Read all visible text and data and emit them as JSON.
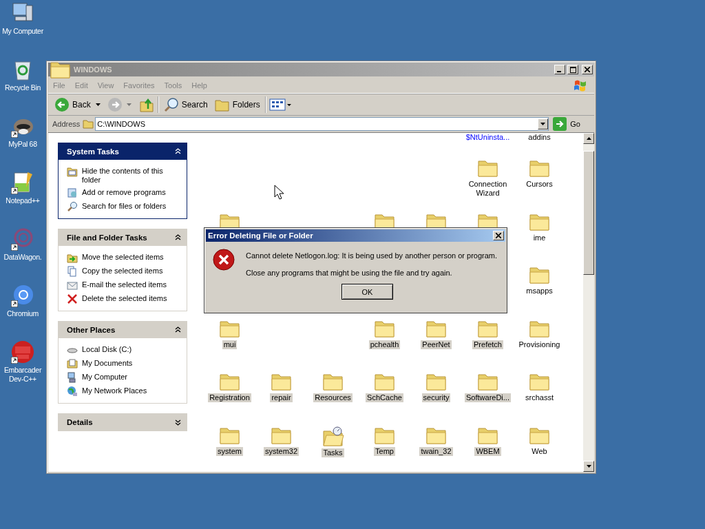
{
  "desktop_icons": [
    {
      "label": "My Computer",
      "kind": "computer"
    },
    {
      "label": "Recycle Bin",
      "kind": "recycle"
    },
    {
      "label": "MyPal 68",
      "kind": "raccoon",
      "shortcut": true
    },
    {
      "label": "Notepad++",
      "kind": "notepad",
      "shortcut": true
    },
    {
      "label": "DataWagon.",
      "kind": "ring",
      "shortcut": true
    },
    {
      "label": "Chromium",
      "kind": "chromium",
      "shortcut": true
    },
    {
      "label": "Embarcader\nDev-C++",
      "kind": "dev",
      "shortcut": true
    }
  ],
  "window": {
    "title": "WINDOWS",
    "active": false,
    "menu": [
      "File",
      "Edit",
      "View",
      "Favorites",
      "Tools",
      "Help"
    ],
    "toolbar": {
      "back": "Back",
      "search": "Search",
      "folders": "Folders"
    },
    "address": {
      "label": "Address",
      "value": "C:\\WINDOWS",
      "go": "Go"
    },
    "task_panes": [
      {
        "title": "System Tasks",
        "kind": "primary",
        "expanded": true,
        "items": [
          {
            "label": "Hide the contents of this folder",
            "kind": "hide"
          },
          {
            "label": "Add or remove programs",
            "kind": "programs"
          },
          {
            "label": "Search for files or folders",
            "kind": "search"
          }
        ]
      },
      {
        "title": "File and Folder Tasks",
        "kind": "normal",
        "expanded": true,
        "items": [
          {
            "label": "Move the selected items",
            "kind": "move"
          },
          {
            "label": "Copy the selected items",
            "kind": "copy"
          },
          {
            "label": "E-mail the selected items",
            "kind": "email"
          },
          {
            "label": "Delete the selected items",
            "kind": "delete"
          }
        ]
      },
      {
        "title": "Other Places",
        "kind": "normal",
        "expanded": true,
        "items": [
          {
            "label": "Local Disk (C:)",
            "kind": "disk"
          },
          {
            "label": "My Documents",
            "kind": "documents"
          },
          {
            "label": "My Computer",
            "kind": "computer"
          },
          {
            "label": "My Network Places",
            "kind": "network"
          }
        ]
      },
      {
        "title": "Details",
        "kind": "normal",
        "expanded": false
      }
    ],
    "file_rows": [
      [
        {
          "kind": "empty"
        },
        {
          "kind": "empty"
        },
        {
          "kind": "empty"
        },
        {
          "kind": "empty"
        },
        {
          "kind": "empty"
        },
        {
          "kind": "cut",
          "name": "$NtUninsta...",
          "compressed": true,
          "selected": false
        },
        {
          "kind": "cut",
          "name": "addins",
          "compressed": false,
          "selected": false
        }
      ],
      [
        {
          "kind": "empty"
        },
        {
          "kind": "empty"
        },
        {
          "kind": "empty"
        },
        {
          "kind": "empty"
        },
        {
          "kind": "empty"
        },
        {
          "kind": "folder",
          "name": "Connection Wizard",
          "selected": false
        },
        {
          "kind": "folder",
          "name": "Cursors",
          "selected": false
        }
      ],
      [
        {
          "kind": "folder"
        },
        {
          "kind": "empty"
        },
        {
          "kind": "empty"
        },
        {
          "kind": "folder"
        },
        {
          "kind": "folder"
        },
        {
          "kind": "folder"
        },
        {
          "kind": "folder",
          "name": "ime",
          "selected": false
        }
      ],
      [
        {
          "kind": "empty"
        },
        {
          "kind": "empty"
        },
        {
          "kind": "empty"
        },
        {
          "kind": "empty"
        },
        {
          "kind": "empty"
        },
        {
          "kind": "empty"
        },
        {
          "kind": "folder",
          "name": "msapps",
          "selected": false
        }
      ],
      [
        {
          "kind": "folder",
          "name": "mui",
          "selected": true
        },
        {
          "kind": "empty"
        },
        {
          "kind": "empty"
        },
        {
          "kind": "folder",
          "name": "pchealth",
          "selected": true
        },
        {
          "kind": "folder",
          "name": "PeerNet",
          "selected": true
        },
        {
          "kind": "folder",
          "name": "Prefetch",
          "selected": true
        },
        {
          "kind": "folder",
          "name": "Provisioning",
          "selected": false
        }
      ],
      [
        {
          "kind": "folder",
          "name": "Registration",
          "selected": true
        },
        {
          "kind": "folder",
          "name": "repair",
          "selected": true
        },
        {
          "kind": "folder",
          "name": "Resources",
          "selected": true
        },
        {
          "kind": "folder",
          "name": "SchCache",
          "selected": true
        },
        {
          "kind": "folder",
          "name": "security",
          "selected": true
        },
        {
          "kind": "folder",
          "name": "SoftwareDi...",
          "selected": true
        },
        {
          "kind": "folder",
          "name": "srchasst",
          "selected": false
        }
      ],
      [
        {
          "kind": "folder",
          "name": "system",
          "selected": true
        },
        {
          "kind": "folder",
          "name": "system32",
          "selected": true
        },
        {
          "kind": "tasks",
          "name": "Tasks",
          "selected": true
        },
        {
          "kind": "folder",
          "name": "Temp",
          "selected": true
        },
        {
          "kind": "folder",
          "name": "twain_32",
          "selected": true
        },
        {
          "kind": "folder",
          "name": "WBEM",
          "selected": true
        },
        {
          "kind": "folder",
          "name": "Web",
          "selected": false
        }
      ]
    ]
  },
  "dialog": {
    "title": "Error Deleting File or Folder",
    "message": "Cannot delete Netlogon.log: It is being used by another person or program.",
    "hint": "Close any programs that might be using the file and try again.",
    "button": "OK"
  }
}
